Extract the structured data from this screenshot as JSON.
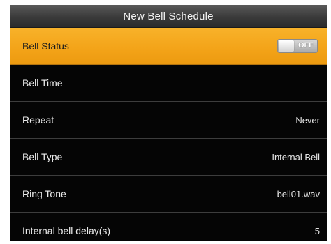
{
  "header": {
    "title": "New Bell Schedule"
  },
  "rows": [
    {
      "label": "Bell Status",
      "toggle": {
        "text": "OFF",
        "on": false
      }
    },
    {
      "label": "Bell Time",
      "value": ""
    },
    {
      "label": "Repeat",
      "value": "Never"
    },
    {
      "label": "Bell Type",
      "value": "Internal Bell"
    },
    {
      "label": "Ring Tone",
      "value": "bell01.wav"
    },
    {
      "label": "Internal bell delay(s)",
      "value": "5"
    }
  ],
  "colors": {
    "selected_row": "#f3a318",
    "background": "#000000",
    "title_bar": "#3a3a3a"
  }
}
